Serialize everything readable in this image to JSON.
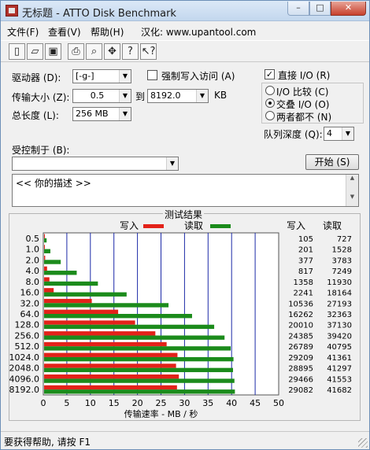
{
  "window": {
    "title": "无标题 - ATTO Disk Benchmark"
  },
  "menu": [
    "文件(F)",
    "查看(V)",
    "帮助(H)",
    "汉化: www.upantool.com"
  ],
  "toolbar": {
    "buttons": [
      "new-icon",
      "open-icon",
      "save-icon",
      "print-icon",
      "print-preview-icon",
      "move-icon",
      "help-icon",
      "context-help-icon"
    ]
  },
  "form": {
    "drive_label": "驱动器 (D):",
    "drive_value": "[-g-]",
    "force_write_label": "强制写入访问 (A)",
    "force_write_checked": false,
    "transfer_label": "传输大小 (Z):",
    "transfer_from": "0.5",
    "to_label": "到",
    "transfer_to": "8192.0",
    "kb_unit": "KB",
    "total_label": "总长度 (L):",
    "total_value": "256 MB",
    "direct_io_label": "直接 I/O (R)",
    "direct_io_checked": true,
    "io_compare_label": "I/O 比较 (C)",
    "overlapped_io_label": "交叠 I/O (O)",
    "neither_label": "两者都不 (N)",
    "selected_io_mode": "交叠 I/O (O)",
    "queue_depth_label": "队列深度 (Q):",
    "queue_depth_value": "4",
    "controlled_by_label": "受控制于 (B):",
    "controlled_by_value": "",
    "start_button": "开始 (S)",
    "description": "<<  你的描述    >>"
  },
  "results": {
    "title": "测试结果",
    "write_col": "写入",
    "read_col": "读取"
  },
  "chart_data": {
    "type": "bar",
    "orientation": "horizontal",
    "title": "测试结果",
    "xlabel": "传输速率 - MB / 秒",
    "xlim": [
      0,
      50
    ],
    "xticks": [
      "0",
      "5",
      "10",
      "15",
      "20",
      "25",
      "30",
      "35",
      "40",
      "45",
      "50"
    ],
    "grid": true,
    "categories": [
      "0.5",
      "1.0",
      "2.0",
      "4.0",
      "8.0",
      "16.0",
      "32.0",
      "64.0",
      "128.0",
      "256.0",
      "512.0",
      "1024.0",
      "2048.0",
      "4096.0",
      "8192.0"
    ],
    "series": [
      {
        "name": "写入",
        "color": "#e32219",
        "values": [
          0.1,
          0.2,
          0.4,
          0.8,
          1.3,
          2.2,
          10.3,
          15.9,
          19.5,
          23.8,
          26.2,
          28.5,
          28.2,
          28.8,
          28.4
        ]
      },
      {
        "name": "读取",
        "color": "#1b8b1b",
        "values": [
          0.7,
          1.5,
          3.7,
          7.1,
          11.6,
          17.7,
          26.6,
          31.6,
          36.3,
          38.5,
          39.8,
          40.4,
          40.3,
          40.6,
          40.7
        ]
      }
    ],
    "write_kbps": [
      "105",
      "201",
      "377",
      "817",
      "1358",
      "2241",
      "10536",
      "16262",
      "20010",
      "24385",
      "26789",
      "29209",
      "28895",
      "29466",
      "29082"
    ],
    "read_kbps": [
      "727",
      "1528",
      "3783",
      "7249",
      "11930",
      "18164",
      "27193",
      "32363",
      "37130",
      "39420",
      "40795",
      "41361",
      "41297",
      "41553",
      "41682"
    ]
  },
  "status": {
    "text": "要获得帮助, 请按 F1"
  }
}
